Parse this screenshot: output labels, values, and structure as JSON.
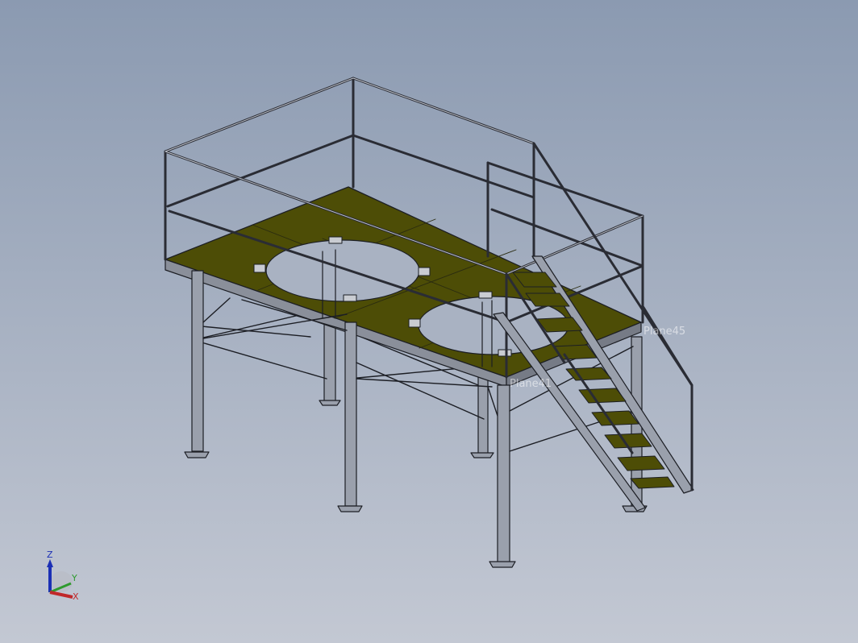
{
  "viewport": {
    "background_top": "#8b9ab1",
    "background_bottom": "#c3c8d3"
  },
  "model": {
    "name": "steel-platform-with-stair",
    "deck_color": "#4d4d06",
    "steel_color": "#9aa0ac",
    "edge_color": "#1c1e24"
  },
  "labels": {
    "plane_a": "Plane45",
    "plane_b": "Plane41"
  },
  "triad": {
    "z": "Z",
    "y": "Y",
    "x": "X",
    "z_color": "#1b2fb5",
    "y_color": "#2e9a2e",
    "x_color": "#c0282a"
  }
}
